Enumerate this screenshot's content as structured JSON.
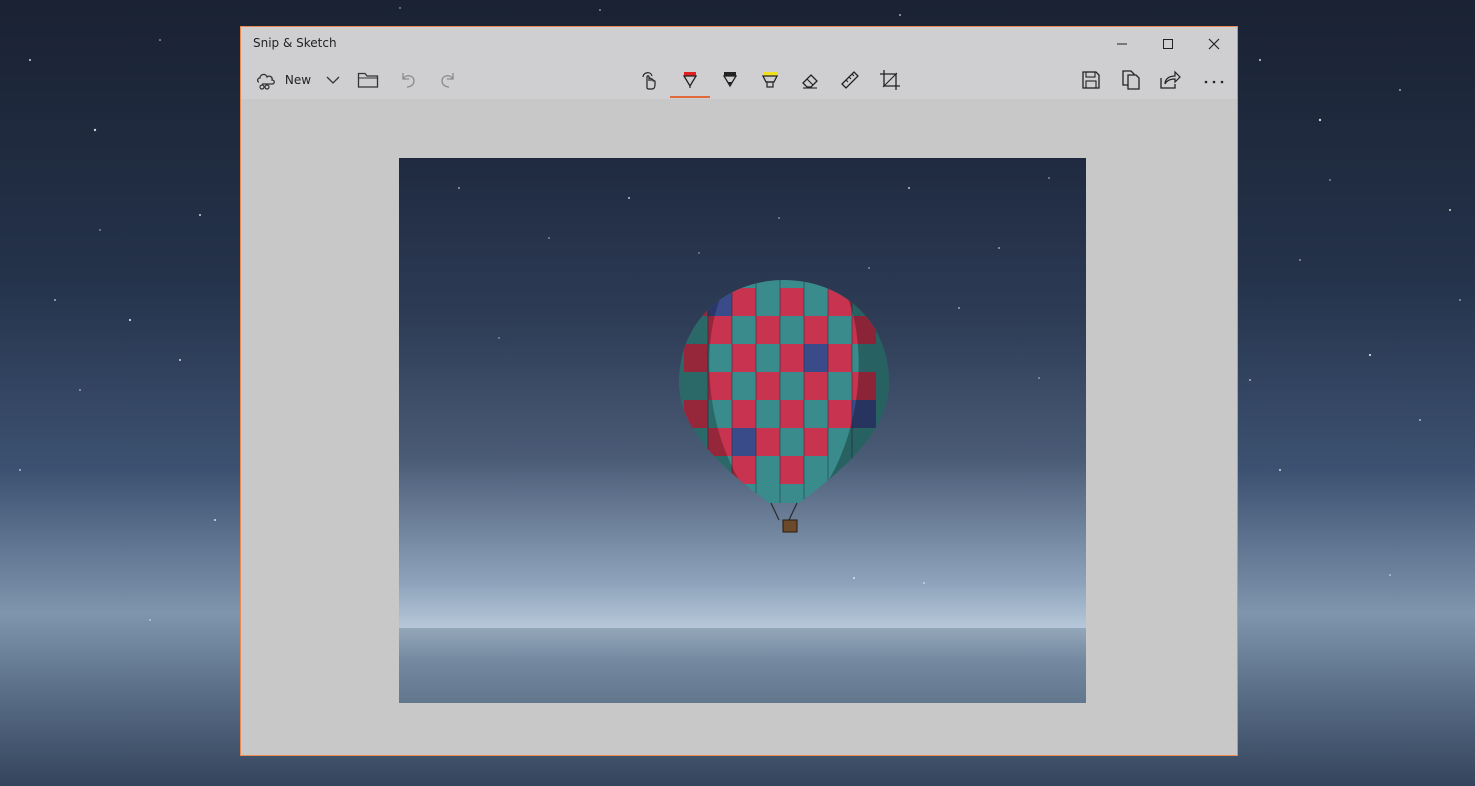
{
  "window": {
    "title": "Snip & Sketch",
    "accent_color": "#e98a55"
  },
  "caption": {
    "minimize_icon": "minimize-icon",
    "maximize_icon": "maximize-icon",
    "close_icon": "close-icon"
  },
  "toolbar": {
    "new_label": "New",
    "left_icons": [
      "new-snip-icon",
      "chevron-down-icon",
      "open-folder-icon",
      "undo-icon",
      "redo-icon"
    ],
    "center_icons": [
      "touch-writing-icon",
      "ballpoint-pen-icon",
      "pencil-icon",
      "highlighter-icon",
      "eraser-icon",
      "ruler-icon",
      "crop-icon"
    ],
    "right_icons": [
      "save-icon",
      "copy-icon",
      "share-icon",
      "more-icon"
    ],
    "active_tool": "ballpoint-pen",
    "pen_color": "#e02020",
    "highlighter_color": "#f0e020"
  },
  "canvas": {
    "image_subject": "hot air balloon over calm sea at night"
  }
}
